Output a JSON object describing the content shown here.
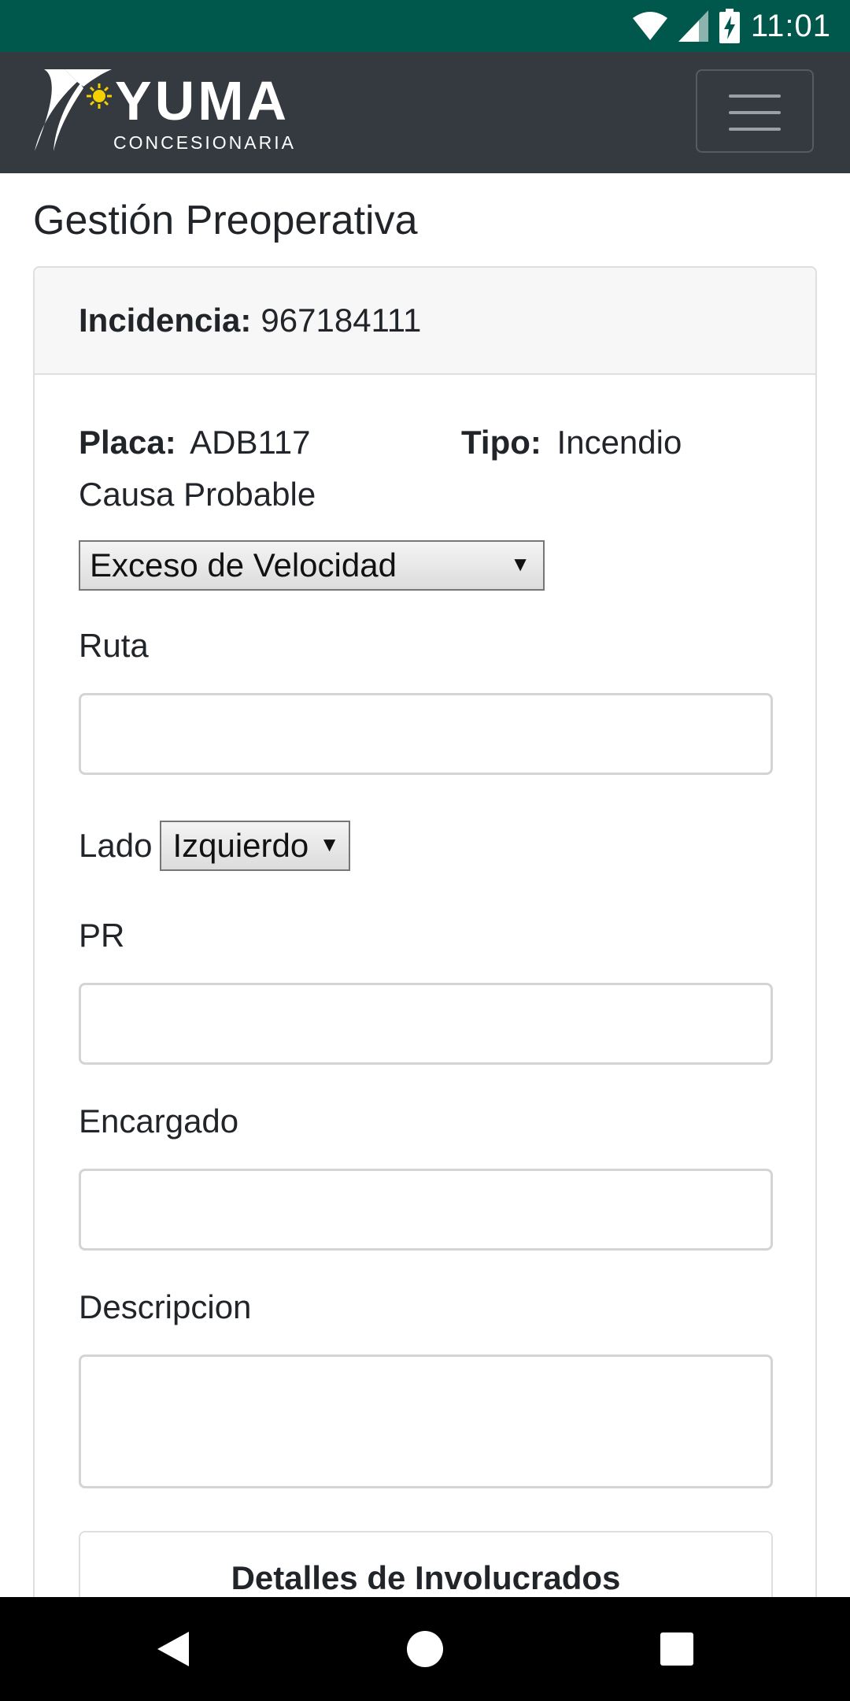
{
  "status_bar": {
    "time": "11:01",
    "icons": [
      "wifi-icon",
      "signal-icon",
      "battery-charging-icon"
    ]
  },
  "header": {
    "logo_main": "YUMA",
    "logo_sub": "CONCESIONARIA",
    "menu_icon": "hamburger-menu-icon"
  },
  "page": {
    "title": "Gestión Preoperativa"
  },
  "card": {
    "incidencia_label": "Incidencia:",
    "incidencia_value": "967184111",
    "placa_label": "Placa:",
    "placa_value": "ADB117",
    "tipo_label": "Tipo:",
    "tipo_value": "Incendio",
    "causa_label": "Causa Probable",
    "causa_selected": "Exceso de Velocidad",
    "ruta_label": "Ruta",
    "ruta_value": "",
    "lado_label": "Lado",
    "lado_selected": "Izquierdo",
    "pr_label": "PR",
    "pr_value": "",
    "encargado_label": "Encargado",
    "encargado_value": "",
    "descripcion_label": "Descripcion",
    "descripcion_value": "",
    "detalles_label": "Detalles de Involucrados"
  },
  "nav_bar": {
    "buttons": [
      "back-icon",
      "home-icon",
      "recents-icon"
    ]
  }
}
